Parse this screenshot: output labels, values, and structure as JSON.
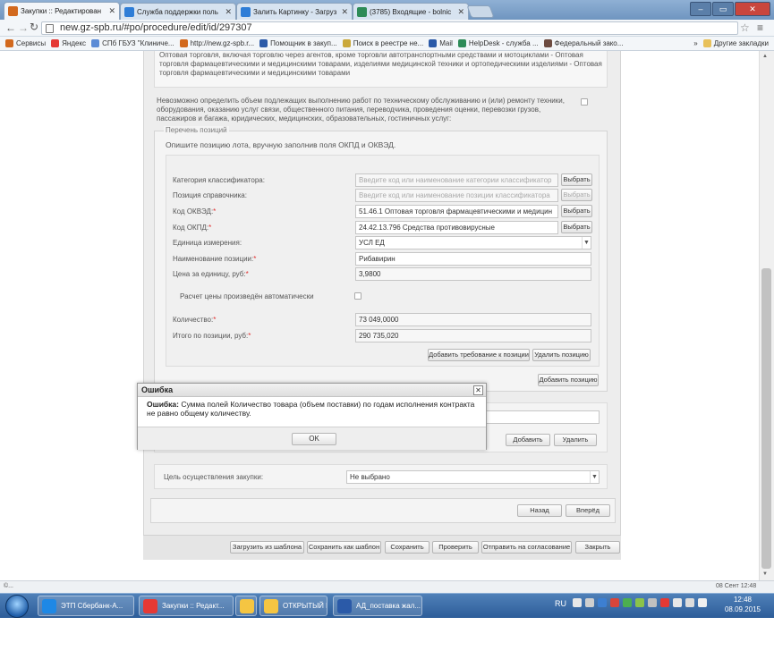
{
  "browser": {
    "tabs": [
      {
        "title": "Закупки :: Редактирован",
        "active": true,
        "color": "#d2691e"
      },
      {
        "title": "Служба поддержки поль",
        "active": false,
        "color": "#2e7dd7"
      },
      {
        "title": "Залить Картинку - Загруз",
        "active": false,
        "color": "#2e7dd7"
      },
      {
        "title": "(3785) Входящие - bolnic",
        "active": false,
        "color": "#2e8b57"
      }
    ],
    "url": "new.gz-spb.ru/#po/procedure/edit/id/297307",
    "bookmarks": [
      {
        "label": "Сервисы",
        "color": "#d2691e"
      },
      {
        "label": "Яндекс",
        "color": "#e53935"
      },
      {
        "label": "СПб ГБУЗ \"Клиниче...",
        "color": "#5b8bd6"
      },
      {
        "label": "http://new.gz-spb.r...",
        "color": "#d2691e"
      },
      {
        "label": "Помощник в закуп...",
        "color": "#2b5aa8"
      },
      {
        "label": "Поиск в реестре не...",
        "color": "#caa83a"
      },
      {
        "label": "Mail",
        "color": "#2b5aa8"
      },
      {
        "label": "HelpDesk - служба ...",
        "color": "#2e8b57"
      },
      {
        "label": "Федеральный закo...",
        "color": "#6d4c41"
      }
    ],
    "bookmarks_more": "»",
    "other_bookmarks": "Другие закладки"
  },
  "form": {
    "okved_desc": "Оптовая торговля, включая торговлю через агентов, кроме торговли автотранспортными средствами и мотоциклами - Оптовая торговля фармацевтическими и медицинскими товарами, изделиями медицинской техники и ортопедическими изделиями - Оптовая торговля фармацевтическими и медицинскими товарами",
    "cannot_determine_label": "Невозможно определить объем подлежащих выполнению работ по техническому обслуживанию и (или) ремонту техники, оборудования, оказанию услуг связи, общественного питания, переводчика, проведения оценки, перевозки грузов, пассажиров и багажа, юридических, медицинских, образовательных, гостиничных услуг:",
    "positions_legend": "Перечень позиций",
    "positions_hint": "Опишите позицию лота, вручную заполнив поля ОКПД и ОКВЭД.",
    "fields": {
      "category_label": "Категория классификатора:",
      "category_placeholder": "Введите код или наименование категории классификатор",
      "position_label": "Позиция справочника:",
      "position_placeholder": "Введите код или наименование позиции классификатора",
      "okved_label": "Код ОКВЭД:",
      "okved_value": "51.46.1 Оптовая торговля фармацевтическими и медицин",
      "okpd_label": "Код ОКПД:",
      "okpd_value": "24.42.13.796 Средства противовирусные",
      "unit_label": "Единица измерения:",
      "unit_value": "УСЛ ЕД",
      "name_label": "Наименование позиции:",
      "name_value": "Рибавирин",
      "price_label": "Цена за единицу, руб:",
      "price_value": "3,9800",
      "auto_price_label": "Расчет цены произведён автоматически",
      "qty_label": "Количество:",
      "qty_value": "73 049,0000",
      "total_label": "Итого по позиции, руб:",
      "total_value": "290 735,020",
      "required_mark": "*"
    },
    "select_btn": "Выбрать",
    "add_requirement_btn": "Добавить требование к позиции",
    "delete_position_btn": "Удалить позицию",
    "add_position_btn": "Добавить позицию",
    "add_btn": "Добавить",
    "delete_btn": "Удалить",
    "purpose_label": "Цель осуществления закупки:",
    "purpose_value": "Не выбрано",
    "back_btn": "Назад",
    "next_btn": "Вперёд",
    "footer_buttons": [
      "Загрузить из шаблона",
      "Сохранить как шаблон",
      "Сохранить",
      "Проверить",
      "Отправить на согласование",
      "Закрыть"
    ]
  },
  "dialog": {
    "title": "Ошибка",
    "close": "✕",
    "message_bold": "Ошибка:",
    "message": " Сумма полей Количество товара (объем поставки) по годам исполнения контракта не равно общему количеству.",
    "ok": "OK"
  },
  "statusbar": {
    "left": "©...",
    "right": "08 Сент 12:48"
  },
  "taskbar": {
    "items": [
      {
        "label": "ЭТП Сбербанк-А...",
        "color": "#1e88e5"
      },
      {
        "label": "Закупки :: Редакт...",
        "color": "#e53935"
      },
      {
        "label": "",
        "color": "#f5c542"
      },
      {
        "label": "ОТКРЫТЫЙ КОН...",
        "color": "#f5c542"
      },
      {
        "label": "АД_поставка жал...",
        "color": "#2b5aa8"
      }
    ],
    "lang": "RU",
    "time": "12:48",
    "date": "08.09.2015"
  }
}
